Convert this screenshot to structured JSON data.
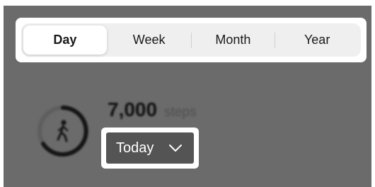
{
  "period_tabs": {
    "items": [
      {
        "label": "Day",
        "selected": true
      },
      {
        "label": "Week",
        "selected": false
      },
      {
        "label": "Month",
        "selected": false
      },
      {
        "label": "Year",
        "selected": false
      }
    ]
  },
  "activity": {
    "steps_value": "7,000",
    "steps_unit": "steps",
    "icon": "walking-person-icon"
  },
  "date_dropdown": {
    "selected": "Today",
    "icon": "chevron-down-icon"
  },
  "colors": {
    "overlay": "#6b6b6b",
    "highlight": "#ffffff",
    "dropdown_bg": "#545454"
  }
}
